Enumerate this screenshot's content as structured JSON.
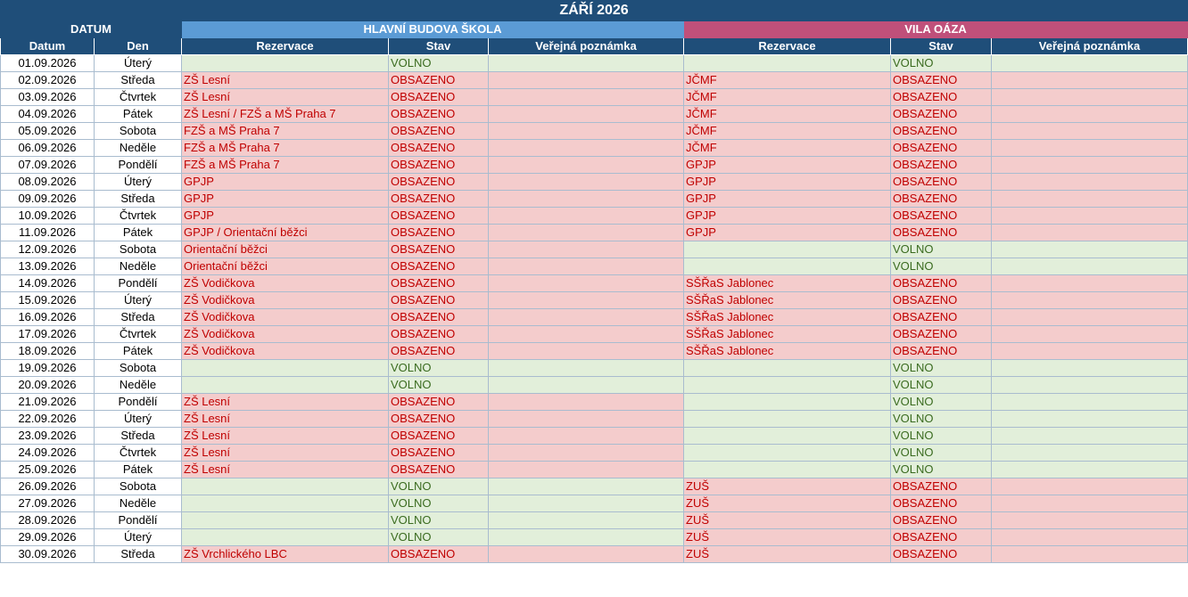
{
  "title": "ZÁŘÍ 2026",
  "groups": {
    "datum": "DATUM",
    "a": "HLAVNÍ BUDOVA ŠKOLA",
    "b": "VILA OÁZA"
  },
  "headers": {
    "date": "Datum",
    "day": "Den",
    "res": "Rezervace",
    "status": "Stav",
    "note": "Veřejná poznámka"
  },
  "colors": {
    "free_bg": "#e2efda",
    "busy_bg": "#f4cccc",
    "header": "#1f4e79",
    "group_a": "#5b9bd5",
    "group_b": "#c0507a"
  },
  "rows": [
    {
      "date": "01.09.2026",
      "day": "Úterý",
      "a_res": "",
      "a_status": "VOLNO",
      "b_res": "",
      "b_status": "VOLNO"
    },
    {
      "date": "02.09.2026",
      "day": "Středa",
      "a_res": "ZŠ Lesní",
      "a_status": "OBSAZENO",
      "b_res": "JČMF",
      "b_status": "OBSAZENO"
    },
    {
      "date": "03.09.2026",
      "day": "Čtvrtek",
      "a_res": "ZŠ Lesní",
      "a_status": "OBSAZENO",
      "b_res": "JČMF",
      "b_status": "OBSAZENO"
    },
    {
      "date": "04.09.2026",
      "day": "Pátek",
      "a_res": "ZŠ Lesní / FZŠ a MŠ Praha 7",
      "a_status": "OBSAZENO",
      "b_res": "JČMF",
      "b_status": "OBSAZENO"
    },
    {
      "date": "05.09.2026",
      "day": "Sobota",
      "a_res": "FZŠ a MŠ Praha 7",
      "a_status": "OBSAZENO",
      "b_res": "JČMF",
      "b_status": "OBSAZENO"
    },
    {
      "date": "06.09.2026",
      "day": "Neděle",
      "a_res": "FZŠ a MŠ Praha 7",
      "a_status": "OBSAZENO",
      "b_res": "JČMF",
      "b_status": "OBSAZENO"
    },
    {
      "date": "07.09.2026",
      "day": "Pondělí",
      "a_res": "FZŠ a MŠ Praha 7",
      "a_status": "OBSAZENO",
      "b_res": "GPJP",
      "b_status": "OBSAZENO"
    },
    {
      "date": "08.09.2026",
      "day": "Úterý",
      "a_res": "GPJP",
      "a_status": "OBSAZENO",
      "b_res": "GPJP",
      "b_status": "OBSAZENO"
    },
    {
      "date": "09.09.2026",
      "day": "Středa",
      "a_res": "GPJP",
      "a_status": "OBSAZENO",
      "b_res": "GPJP",
      "b_status": "OBSAZENO"
    },
    {
      "date": "10.09.2026",
      "day": "Čtvrtek",
      "a_res": "GPJP",
      "a_status": "OBSAZENO",
      "b_res": "GPJP",
      "b_status": "OBSAZENO"
    },
    {
      "date": "11.09.2026",
      "day": "Pátek",
      "a_res": "GPJP / Orientační běžci",
      "a_status": "OBSAZENO",
      "b_res": "GPJP",
      "b_status": "OBSAZENO"
    },
    {
      "date": "12.09.2026",
      "day": "Sobota",
      "a_res": "Orientační běžci",
      "a_status": "OBSAZENO",
      "b_res": "",
      "b_status": "VOLNO"
    },
    {
      "date": "13.09.2026",
      "day": "Neděle",
      "a_res": "Orientační běžci",
      "a_status": "OBSAZENO",
      "b_res": "",
      "b_status": "VOLNO"
    },
    {
      "date": "14.09.2026",
      "day": "Pondělí",
      "a_res": "ZŠ Vodičkova",
      "a_status": "OBSAZENO",
      "b_res": "SŠŘaS Jablonec",
      "b_status": "OBSAZENO"
    },
    {
      "date": "15.09.2026",
      "day": "Úterý",
      "a_res": "ZŠ Vodičkova",
      "a_status": "OBSAZENO",
      "b_res": "SŠŘaS Jablonec",
      "b_status": "OBSAZENO"
    },
    {
      "date": "16.09.2026",
      "day": "Středa",
      "a_res": "ZŠ Vodičkova",
      "a_status": "OBSAZENO",
      "b_res": "SŠŘaS Jablonec",
      "b_status": "OBSAZENO"
    },
    {
      "date": "17.09.2026",
      "day": "Čtvrtek",
      "a_res": "ZŠ Vodičkova",
      "a_status": "OBSAZENO",
      "b_res": "SŠŘaS Jablonec",
      "b_status": "OBSAZENO"
    },
    {
      "date": "18.09.2026",
      "day": "Pátek",
      "a_res": "ZŠ Vodičkova",
      "a_status": "OBSAZENO",
      "b_res": "SŠŘaS Jablonec",
      "b_status": "OBSAZENO"
    },
    {
      "date": "19.09.2026",
      "day": "Sobota",
      "a_res": "",
      "a_status": "VOLNO",
      "b_res": "",
      "b_status": "VOLNO"
    },
    {
      "date": "20.09.2026",
      "day": "Neděle",
      "a_res": "",
      "a_status": "VOLNO",
      "b_res": "",
      "b_status": "VOLNO"
    },
    {
      "date": "21.09.2026",
      "day": "Pondělí",
      "a_res": "ZŠ Lesní",
      "a_status": "OBSAZENO",
      "b_res": "",
      "b_status": "VOLNO"
    },
    {
      "date": "22.09.2026",
      "day": "Úterý",
      "a_res": "ZŠ Lesní",
      "a_status": "OBSAZENO",
      "b_res": "",
      "b_status": "VOLNO"
    },
    {
      "date": "23.09.2026",
      "day": "Středa",
      "a_res": "ZŠ Lesní",
      "a_status": "OBSAZENO",
      "b_res": "",
      "b_status": "VOLNO"
    },
    {
      "date": "24.09.2026",
      "day": "Čtvrtek",
      "a_res": "ZŠ Lesní",
      "a_status": "OBSAZENO",
      "b_res": "",
      "b_status": "VOLNO"
    },
    {
      "date": "25.09.2026",
      "day": "Pátek",
      "a_res": "ZŠ Lesní",
      "a_status": "OBSAZENO",
      "b_res": "",
      "b_status": "VOLNO"
    },
    {
      "date": "26.09.2026",
      "day": "Sobota",
      "a_res": "",
      "a_status": "VOLNO",
      "b_res": "ZUŠ",
      "b_status": "OBSAZENO"
    },
    {
      "date": "27.09.2026",
      "day": "Neděle",
      "a_res": "",
      "a_status": "VOLNO",
      "b_res": "ZUŠ",
      "b_status": "OBSAZENO"
    },
    {
      "date": "28.09.2026",
      "day": "Pondělí",
      "a_res": "",
      "a_status": "VOLNO",
      "b_res": "ZUŠ",
      "b_status": "OBSAZENO"
    },
    {
      "date": "29.09.2026",
      "day": "Úterý",
      "a_res": "",
      "a_status": "VOLNO",
      "b_res": "ZUŠ",
      "b_status": "OBSAZENO"
    },
    {
      "date": "30.09.2026",
      "day": "Středa",
      "a_res": "ZŠ Vrchlického LBC",
      "a_status": "OBSAZENO",
      "b_res": "ZUŠ",
      "b_status": "OBSAZENO"
    }
  ]
}
